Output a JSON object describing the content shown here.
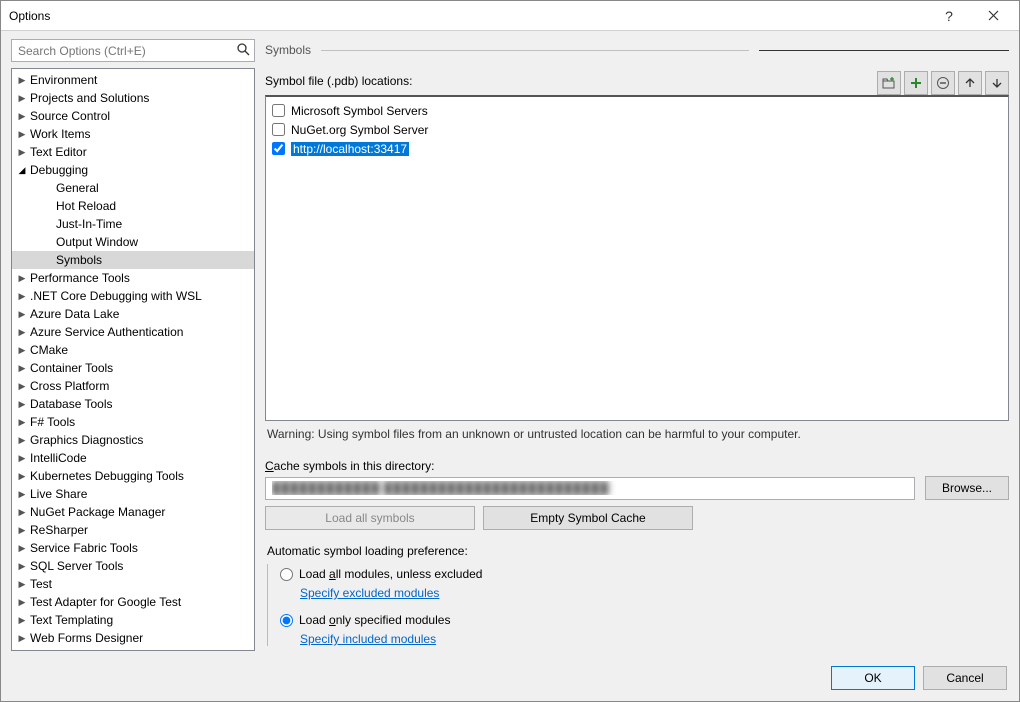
{
  "window": {
    "title": "Options"
  },
  "search": {
    "placeholder": "Search Options (Ctrl+E)"
  },
  "tree": {
    "items": [
      {
        "label": "Environment",
        "arrow": "▶",
        "depth": 1
      },
      {
        "label": "Projects and Solutions",
        "arrow": "▶",
        "depth": 1
      },
      {
        "label": "Source Control",
        "arrow": "▶",
        "depth": 1
      },
      {
        "label": "Work Items",
        "arrow": "▶",
        "depth": 1
      },
      {
        "label": "Text Editor",
        "arrow": "▶",
        "depth": 1
      },
      {
        "label": "Debugging",
        "arrow": "◢",
        "depth": 1,
        "expanded": true
      },
      {
        "label": "General",
        "arrow": "",
        "depth": 2
      },
      {
        "label": "Hot Reload",
        "arrow": "",
        "depth": 2
      },
      {
        "label": "Just-In-Time",
        "arrow": "",
        "depth": 2
      },
      {
        "label": "Output Window",
        "arrow": "",
        "depth": 2
      },
      {
        "label": "Symbols",
        "arrow": "",
        "depth": 2,
        "selected": true
      },
      {
        "label": "Performance Tools",
        "arrow": "▶",
        "depth": 1
      },
      {
        "label": ".NET Core Debugging with WSL",
        "arrow": "▶",
        "depth": 1
      },
      {
        "label": "Azure Data Lake",
        "arrow": "▶",
        "depth": 1
      },
      {
        "label": "Azure Service Authentication",
        "arrow": "▶",
        "depth": 1
      },
      {
        "label": "CMake",
        "arrow": "▶",
        "depth": 1
      },
      {
        "label": "Container Tools",
        "arrow": "▶",
        "depth": 1
      },
      {
        "label": "Cross Platform",
        "arrow": "▶",
        "depth": 1
      },
      {
        "label": "Database Tools",
        "arrow": "▶",
        "depth": 1
      },
      {
        "label": "F# Tools",
        "arrow": "▶",
        "depth": 1
      },
      {
        "label": "Graphics Diagnostics",
        "arrow": "▶",
        "depth": 1
      },
      {
        "label": "IntelliCode",
        "arrow": "▶",
        "depth": 1
      },
      {
        "label": "Kubernetes Debugging Tools",
        "arrow": "▶",
        "depth": 1
      },
      {
        "label": "Live Share",
        "arrow": "▶",
        "depth": 1
      },
      {
        "label": "NuGet Package Manager",
        "arrow": "▶",
        "depth": 1
      },
      {
        "label": "ReSharper",
        "arrow": "▶",
        "depth": 1
      },
      {
        "label": "Service Fabric Tools",
        "arrow": "▶",
        "depth": 1
      },
      {
        "label": "SQL Server Tools",
        "arrow": "▶",
        "depth": 1
      },
      {
        "label": "Test",
        "arrow": "▶",
        "depth": 1
      },
      {
        "label": "Test Adapter for Google Test",
        "arrow": "▶",
        "depth": 1
      },
      {
        "label": "Text Templating",
        "arrow": "▶",
        "depth": 1
      },
      {
        "label": "Web Forms Designer",
        "arrow": "▶",
        "depth": 1
      }
    ]
  },
  "page": {
    "heading": "Symbols",
    "locations_label": "Symbol file (.pdb) locations:",
    "symbol_items": [
      {
        "label": "Microsoft Symbol Servers",
        "checked": false
      },
      {
        "label": "NuGet.org Symbol Server",
        "checked": false
      },
      {
        "label": "http://localhost:33417",
        "checked": true,
        "highlighted": true
      }
    ],
    "warning": "Warning: Using symbol files from an unknown or untrusted location can be harmful to your computer.",
    "cache_label": "Cache symbols in this directory:",
    "cache_value": "████████████ █████████████████████████",
    "browse": "Browse...",
    "load_all": "Load all symbols",
    "empty_cache": "Empty Symbol Cache",
    "pref_heading": "Automatic symbol loading preference:",
    "pref1_pre": "Load ",
    "pref1_u": "a",
    "pref1_post": "ll modules, unless excluded",
    "pref1_link": "Specify excluded modules",
    "pref2_pre": "Load ",
    "pref2_u": "o",
    "pref2_post": "nly specified modules",
    "pref2_link": "Specify included modules"
  },
  "footer": {
    "ok": "OK",
    "cancel": "Cancel"
  },
  "accesskeys": {
    "c_pre": "",
    "c_u": "C",
    "c_post": "ache symbols in this directory:"
  }
}
